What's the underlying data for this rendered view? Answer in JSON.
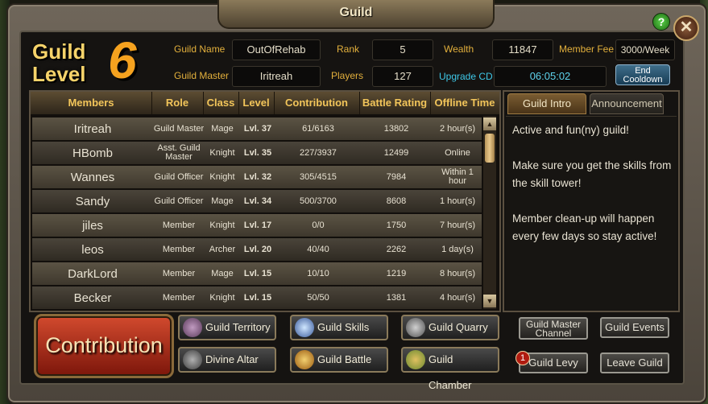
{
  "window": {
    "title": "Guild",
    "help_label": "?",
    "close_label": "✕"
  },
  "guild_level": {
    "label_line1": "Guild",
    "label_line2": "Level",
    "level": "6"
  },
  "info": {
    "guild_name_label": "Guild Name",
    "guild_name": "OutOfRehab",
    "guild_master_label": "Guild Master",
    "guild_master": "Iritreah",
    "rank_label": "Rank",
    "rank": "5",
    "players_label": "Players",
    "players": "127",
    "wealth_label": "Wealth",
    "wealth": "11847",
    "upgrade_cd_label": "Upgrade CD",
    "upgrade_cd": "06:05:02",
    "member_fee_label": "Member Fee",
    "member_fee": "3000/Week",
    "end_cooldown_line1": "End",
    "end_cooldown_line2": "Cooldown"
  },
  "table": {
    "headers": [
      "Members",
      "Role",
      "Class",
      "Level",
      "Contribution",
      "Battle Rating",
      "Offline Time"
    ],
    "rows": [
      {
        "name": "Iritreah",
        "role": "Guild Master",
        "class": "Mage",
        "level": "Lvl. 37",
        "contribution": "61/6163",
        "rating": "13802",
        "offline": "2 hour(s)"
      },
      {
        "name": "HBomb",
        "role": "Asst. Guild Master",
        "class": "Knight",
        "level": "Lvl. 35",
        "contribution": "227/3937",
        "rating": "12499",
        "offline": "Online"
      },
      {
        "name": "Wannes",
        "role": "Guild Officer",
        "class": "Knight",
        "level": "Lvl. 32",
        "contribution": "305/4515",
        "rating": "7984",
        "offline": "Within 1 hour"
      },
      {
        "name": "Sandy",
        "role": "Guild Officer",
        "class": "Mage",
        "level": "Lvl. 34",
        "contribution": "500/3700",
        "rating": "8608",
        "offline": "1 hour(s)"
      },
      {
        "name": "jiles",
        "role": "Member",
        "class": "Knight",
        "level": "Lvl. 17",
        "contribution": "0/0",
        "rating": "1750",
        "offline": "7 hour(s)"
      },
      {
        "name": "leos",
        "role": "Member",
        "class": "Archer",
        "level": "Lvl. 20",
        "contribution": "40/40",
        "rating": "2262",
        "offline": "1 day(s)"
      },
      {
        "name": "DarkLord",
        "role": "Member",
        "class": "Mage",
        "level": "Lvl. 15",
        "contribution": "10/10",
        "rating": "1219",
        "offline": "8 hour(s)"
      },
      {
        "name": "Becker",
        "role": "Member",
        "class": "Knight",
        "level": "Lvl. 15",
        "contribution": "50/50",
        "rating": "1381",
        "offline": "4 hour(s)"
      }
    ]
  },
  "side": {
    "tab_intro": "Guild Intro",
    "tab_announcement": "Announcement",
    "intro_p1": "Active and fun(ny) guild!",
    "intro_p2": "Make sure you get the skills from the skill tower!",
    "intro_p3": "Member clean-up will happen every few days so stay active!"
  },
  "buttons": {
    "contribution": "Contribution",
    "guild_territory": "Guild Territory",
    "guild_skills": "Guild Skills",
    "guild_quarry": "Guild Quarry",
    "divine_altar": "Divine Altar",
    "guild_battle": "Guild Battle",
    "guild_chamber": "Guild Chamber",
    "gm_channel_line1": "Guild Master",
    "gm_channel_line2": "Channel",
    "guild_events": "Guild Events",
    "guild_levy": "Guild Levy",
    "guild_levy_badge": "1",
    "leave_guild": "Leave Guild"
  },
  "colors": {
    "accent_gold": "#e3b03c",
    "cyan": "#3ec8e8",
    "contribution_red": "#b23220"
  },
  "icons": [
    "help-icon",
    "close-icon",
    "territory-icon",
    "skills-icon",
    "quarry-icon",
    "altar-icon",
    "battle-icon",
    "chamber-icon",
    "scroll-up-icon",
    "scroll-down-icon"
  ]
}
